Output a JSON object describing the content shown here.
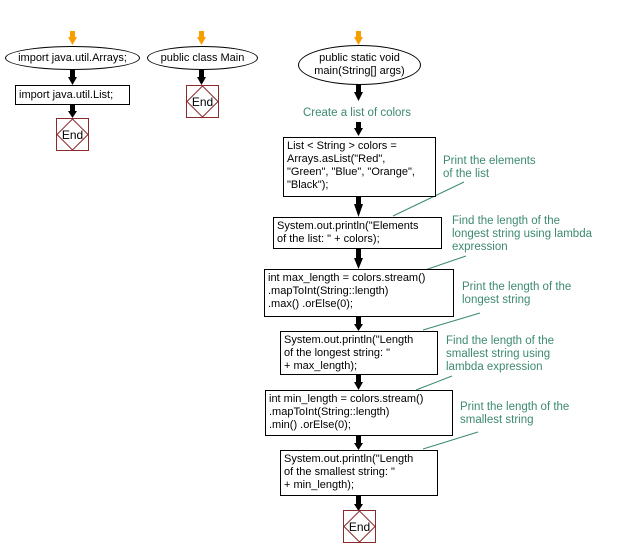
{
  "colors": {
    "start_arrow": "#f5a000",
    "flow_arrow": "#000000",
    "end_border": "#8b2a2a",
    "comment_text": "#3d8a6e"
  },
  "flow1": {
    "start": "import java.util.Arrays;",
    "step": "import java.util.List;",
    "end": "End"
  },
  "flow2": {
    "start": "public class Main",
    "end": "End"
  },
  "flow3": {
    "start": "public static void\nmain(String[] args)",
    "label": "Create a list of colors",
    "steps": [
      "List < String > colors =\nArrays.asList(\"Red\",\n\"Green\", \"Blue\", \"Orange\",\n\"Black\");",
      "System.out.println(\"Elements\nof the list: \" + colors);",
      "int max_length = colors.stream()\n.mapToInt(String::length)\n.max() .orElse(0);",
      "System.out.println(\"Length\nof the longest string: \"\n+ max_length);",
      "int min_length = colors.stream()\n.mapToInt(String::length)\n.min() .orElse(0);",
      "System.out.println(\"Length\nof the smallest string: \"\n+ min_length);"
    ],
    "comments": [
      "Print the elements\nof the list",
      "Find the length of the\nlongest string using lambda\nexpression",
      "Print the length of the\nlongest string",
      "Find the length of the\nsmallest string using\nlambda expression",
      "Print the length of the\nsmallest string"
    ],
    "end": "End"
  }
}
